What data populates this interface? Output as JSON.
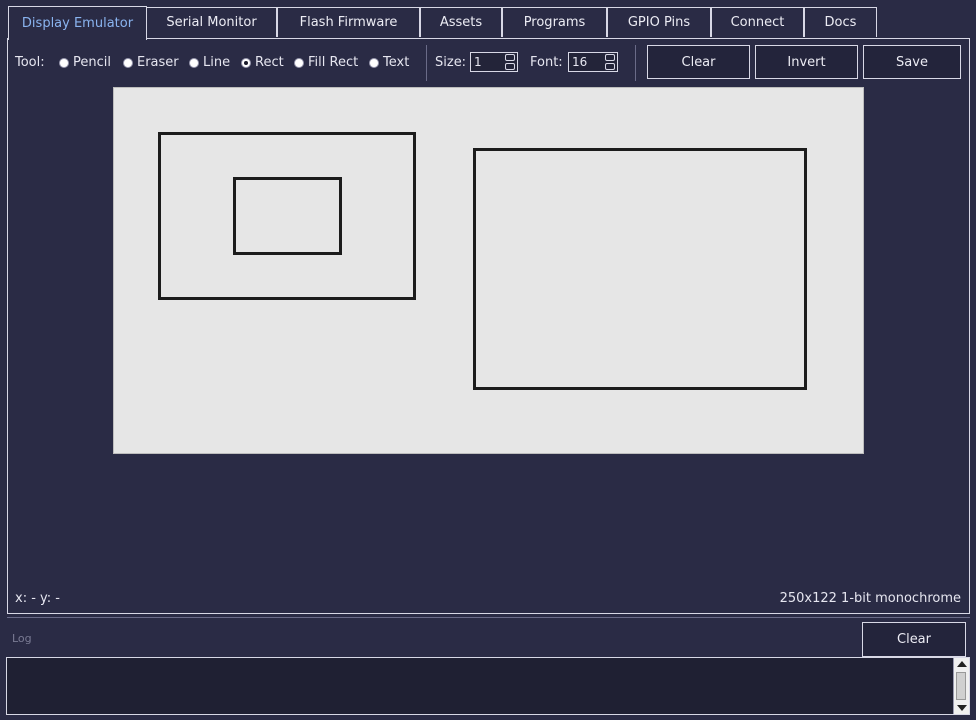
{
  "tabs": [
    {
      "label": "Display Emulator",
      "active": true
    },
    {
      "label": "Serial Monitor"
    },
    {
      "label": "Flash Firmware"
    },
    {
      "label": "Assets"
    },
    {
      "label": "Programs"
    },
    {
      "label": "GPIO Pins"
    },
    {
      "label": "Connect"
    },
    {
      "label": "Docs"
    }
  ],
  "toolbar": {
    "tool_label": "Tool:",
    "tools": [
      {
        "label": "Pencil",
        "checked": false
      },
      {
        "label": "Eraser",
        "checked": false
      },
      {
        "label": "Line",
        "checked": false
      },
      {
        "label": "Rect",
        "checked": true
      },
      {
        "label": "Fill Rect",
        "checked": false
      },
      {
        "label": "Text",
        "checked": false
      }
    ],
    "size_label": "Size:",
    "size_value": "1",
    "font_label": "Font:",
    "font_value": "16",
    "clear_label": "Clear",
    "invert_label": "Invert",
    "save_label": "Save"
  },
  "status": {
    "coords": "x: -  y: -",
    "dims": "250x122  1-bit monochrome"
  },
  "log": {
    "label": "Log",
    "clear_label": "Clear"
  },
  "colors": {
    "background": "#2a2b45",
    "canvas": "#e6e6e6",
    "active_tab_text": "#8ab4f0"
  }
}
